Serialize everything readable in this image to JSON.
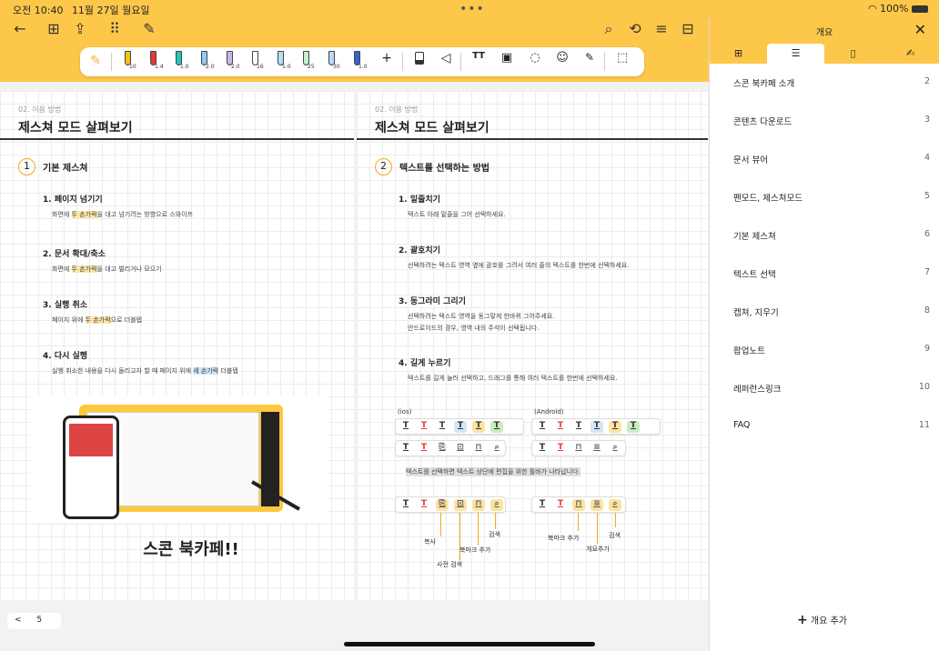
{
  "status": {
    "time": "오전 10:40",
    "date": "11월 27일 월요일",
    "wifi": "WiFi",
    "battery": "100%"
  },
  "toolbar": {
    "back": "←",
    "grid": "⊞",
    "share": "⇪",
    "apps": "⠿",
    "edit": "✎",
    "search": "⌕",
    "rotate": "⟲",
    "menu": "≡",
    "tag": "⊟"
  },
  "pens": [
    {
      "size": "10",
      "color": "#f0c419"
    },
    {
      "size": "1.4",
      "color": "#e53935"
    },
    {
      "size": "1.0",
      "color": "#26c6b8"
    },
    {
      "size": "2.0",
      "color": "#8ecdf0"
    },
    {
      "size": "2.0",
      "color": "#c9b5e8"
    },
    {
      "size": "16",
      "color": "#ffffff"
    },
    {
      "size": "5.0",
      "color": "#b3e0f4"
    },
    {
      "size": "25",
      "color": "#c8f0c8"
    },
    {
      "size": "30",
      "color": "#b9d8f3"
    },
    {
      "size": "1.0",
      "color": "#3366cc"
    }
  ],
  "pentools": {
    "add": "+",
    "text": "TT",
    "image": "▣",
    "lasso": "◌",
    "sticker": "☺",
    "erase": "✎",
    "link": "⬚"
  },
  "page1": {
    "category": "02. 이용 방법",
    "title": "제스쳐 모드 살펴보기",
    "sec_num": "1",
    "sec_title": "기본 제스쳐",
    "items": [
      {
        "title": "1. 페이지 넘기기",
        "d1": "화면에 ",
        "h": "두 손가락",
        "d2": "을 대고 넘기려는 방향으로 스와이프"
      },
      {
        "title": "2. 문서 확대/축소",
        "d1": "화면에 ",
        "h": "두 손가락",
        "d2": "을 대고 벌리거나 모으기"
      },
      {
        "title": "3. 실행 취소",
        "d1": "페이지 위에 ",
        "h": "두 손가락",
        "d2": "으로 더블탭"
      },
      {
        "title": "4. 다시 실행",
        "d1": "실행 취소한 내용을 다시 돌리고자 할 때 페이지 위에 ",
        "h": "세 손가락",
        "d2": " 더블탭"
      }
    ],
    "big_text": "스콘 북카페!!"
  },
  "page2": {
    "category": "02. 이용 방법",
    "title": "제스쳐 모드 살펴보기",
    "sec_num": "2",
    "sec_title": "텍스트를 선택하는 방법",
    "items": [
      {
        "title": "1. 밑줄치기",
        "d": "텍스트 아래 밑줄을 그어 선택하세요."
      },
      {
        "title": "2. 괄호치기",
        "d": "선택하려는 텍스트 영역 옆에 괄호를 그려서 여러 줄의 텍스트를 한번에 선택하세요."
      },
      {
        "title": "3. 동그라미 그리기",
        "d": "선택하려는 텍스트 영역을 동그랗게 한바퀴 그어주세요.",
        "d2": "안드로이드의 경우, 영역 내의 주석이 선택됩니다."
      },
      {
        "title": "4. 길게 누르기",
        "d": "텍스트를 길게 눌러 선택하고, 드래그를 통해 여러 텍스트를 한번에 선택하세요."
      }
    ],
    "ios": "(ios)",
    "android": "(Android)",
    "note": "텍스트를 선택하면 텍스트 상단에 편집을 위한 툴바가 나타납니다.",
    "callouts": {
      "copy": "복사",
      "dict": "사전 검색",
      "bookmark": "북마크 추가",
      "search": "검색",
      "bookmark2": "북마크 추가",
      "outline": "개요추가",
      "search2": "검색"
    }
  },
  "pager": {
    "prev": "<",
    "page": "5"
  },
  "panel": {
    "title": "개요",
    "close": "✕",
    "add": "개요 추가",
    "items": [
      {
        "label": "스콘 북카페 소개",
        "page": "2"
      },
      {
        "label": "콘텐츠 다운로드",
        "page": "3"
      },
      {
        "label": "문서 뷰어",
        "page": "4"
      },
      {
        "label": "펜모드, 제스쳐모드",
        "page": "5"
      },
      {
        "label": "기본 제스쳐",
        "page": "6"
      },
      {
        "label": "텍스트 선택",
        "page": "7"
      },
      {
        "label": "캡쳐, 지우기",
        "page": "8"
      },
      {
        "label": "팝업노트",
        "page": "9"
      },
      {
        "label": "레퍼런스링크",
        "page": "10"
      },
      {
        "label": "FAQ",
        "page": "11"
      }
    ]
  }
}
